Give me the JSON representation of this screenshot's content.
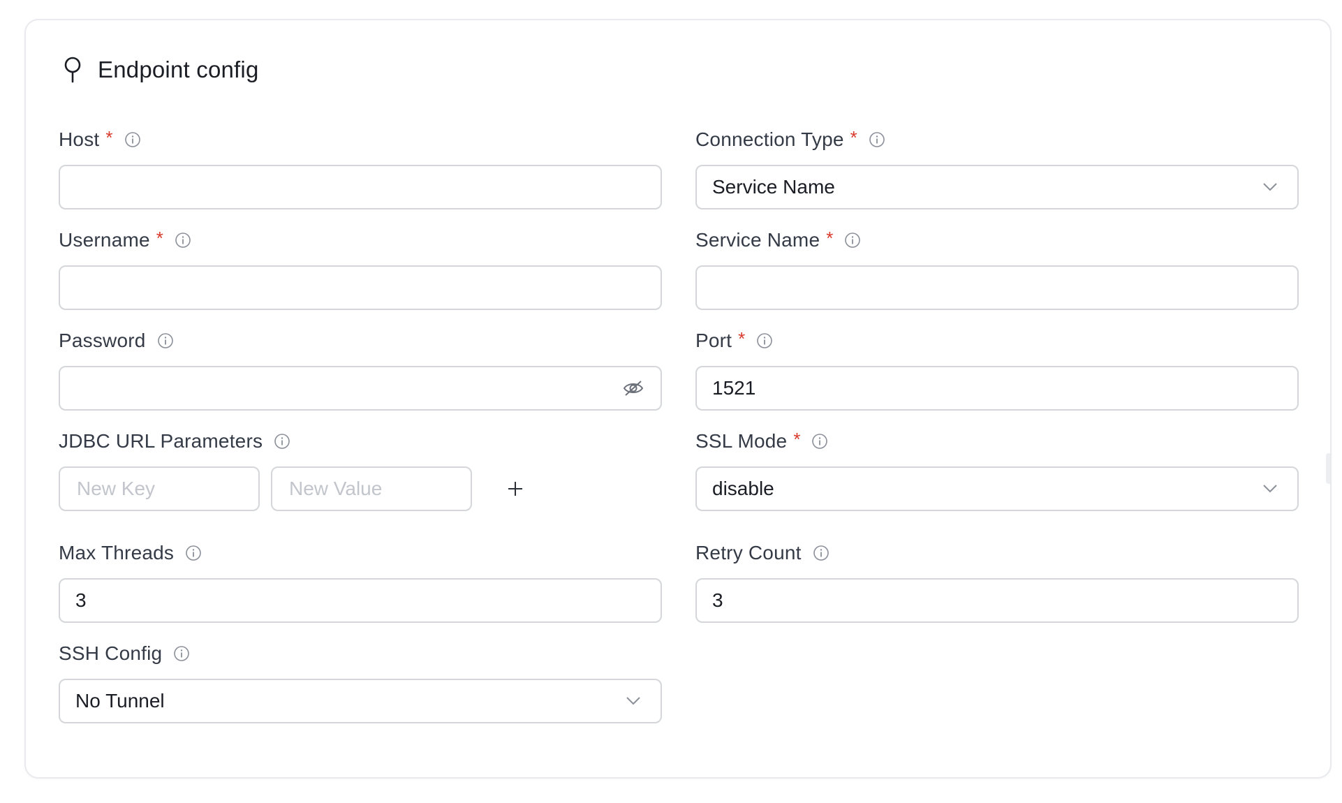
{
  "section": {
    "title": "Endpoint config",
    "icon": "pin-icon"
  },
  "fields": {
    "host": {
      "label": "Host",
      "required": "*",
      "value": ""
    },
    "connection_type": {
      "label": "Connection Type",
      "required": "*",
      "value": "Service Name"
    },
    "username": {
      "label": "Username",
      "required": "*",
      "value": ""
    },
    "service_name": {
      "label": "Service Name",
      "required": "*",
      "value": ""
    },
    "password": {
      "label": "Password",
      "value": ""
    },
    "port": {
      "label": "Port",
      "required": "*",
      "value": "1521"
    },
    "jdbc_params": {
      "label": "JDBC URL Parameters",
      "key_placeholder": "New Key",
      "value_placeholder": "New Value"
    },
    "ssl_mode": {
      "label": "SSL Mode",
      "required": "*",
      "value": "disable"
    },
    "max_threads": {
      "label": "Max Threads",
      "value": "3"
    },
    "retry_count": {
      "label": "Retry Count",
      "value": "3"
    },
    "ssh_config": {
      "label": "SSH Config",
      "value": "No Tunnel"
    }
  },
  "colors": {
    "required": "#d93a2b",
    "border": "#d4d6db",
    "placeholder": "#c2c5cb",
    "label": "#343a46"
  }
}
